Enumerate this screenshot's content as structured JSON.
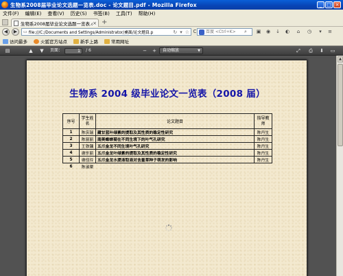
{
  "window": {
    "title": "生物系2008届毕业论文选题一览表.doc - 论文题目.pdf - Mozilla Firefox",
    "minimize": "_",
    "maximize": "□",
    "close": "×"
  },
  "menu": [
    "文件(F)",
    "编辑(E)",
    "查看(V)",
    "历史(S)",
    "书签(B)",
    "工具(T)",
    "帮助(H)"
  ],
  "tabs": [
    {
      "label": "生物系2008届毕业论文选题一览表.d...",
      "close": "×"
    }
  ],
  "newtab": "+",
  "nav": {
    "back": "◀",
    "forward": "▶",
    "url": "file:///C:/Documents and Settings/Administrator/桌面/论文题目.p",
    "search_placeholder": "百度 <Ctrl+K>"
  },
  "bookmarks": [
    {
      "label": "访问最多",
      "color": "#6aa0e8"
    },
    {
      "label": "火狐官方站点",
      "color": "#e88a2a"
    },
    {
      "label": "新手上路",
      "color": "#e0b040"
    },
    {
      "label": "常用网址",
      "color": "#e0b040"
    }
  ],
  "pdf_toolbar": {
    "page_label": "页面：",
    "page_value": "1",
    "page_total": "/ 6",
    "zoom": "自动缩放",
    "zoom_out": "−",
    "zoom_in": "+"
  },
  "document": {
    "title": "生物系 2004 级毕业论文一览表（2008 届）",
    "headers": [
      "序号",
      "学生姓名",
      "论文题目",
      "指导教师"
    ],
    "rows": [
      {
        "no": "1",
        "student": "陈庆瑞",
        "topic": "藏甘蓝叶绿素的提取及其性质的稳定性研究",
        "advisor": "陈丹生"
      },
      {
        "no": "2",
        "student": "陈丽丽",
        "topic": "南美蟛蜞菊在不同生境下的叶气孔研究",
        "advisor": "陈丹生"
      },
      {
        "no": "3",
        "student": "王铁镛",
        "topic": "五爪金龙不同生境叶气孔研究",
        "advisor": "陈丹生"
      },
      {
        "no": "4",
        "student": "谢乐丽",
        "topic": "五爪金龙叶绿素的提取及其性质的稳定性研究",
        "advisor": "陈丹生"
      },
      {
        "no": "5",
        "student": "谢佳玲",
        "topic": "五爪金龙水提液取液对含羞草种子萌发的影响",
        "advisor": "陈丹生"
      },
      {
        "no": "6",
        "student": "陈淑渠",
        "topic": "",
        "advisor": ""
      }
    ]
  }
}
